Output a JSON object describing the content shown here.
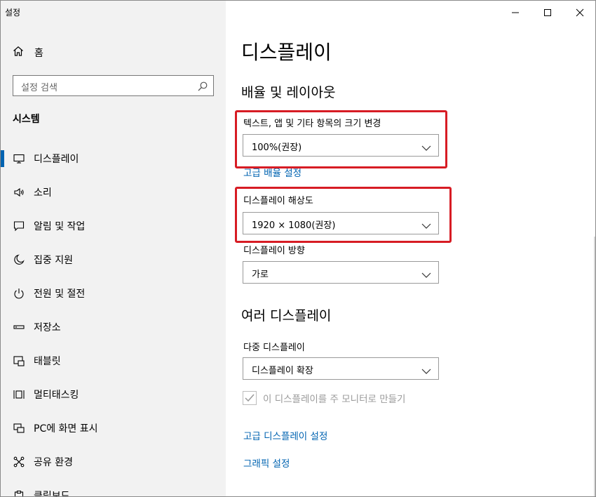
{
  "window": {
    "title": "설정"
  },
  "sidebar": {
    "home_label": "홈",
    "search_placeholder": "설정 검색",
    "section_title": "시스템",
    "items": [
      {
        "label": "디스플레이",
        "icon": "monitor-icon",
        "active": true
      },
      {
        "label": "소리",
        "icon": "speaker-icon"
      },
      {
        "label": "알림 및 작업",
        "icon": "notification-icon"
      },
      {
        "label": "집중 지원",
        "icon": "moon-icon"
      },
      {
        "label": "전원 및 절전",
        "icon": "power-icon"
      },
      {
        "label": "저장소",
        "icon": "storage-icon"
      },
      {
        "label": "태블릿",
        "icon": "tablet-icon"
      },
      {
        "label": "멀티태스킹",
        "icon": "multitasking-icon"
      },
      {
        "label": "PC에 화면 표시",
        "icon": "project-icon"
      },
      {
        "label": "공유 환경",
        "icon": "share-icon"
      },
      {
        "label": "클립보드",
        "icon": "clipboard-icon"
      }
    ]
  },
  "main": {
    "page_title": "디스플레이",
    "scale_section_title": "배율 및 레이아웃",
    "scale_label": "텍스트, 앱 및 기타 항목의 크기 변경",
    "scale_value": "100%(권장)",
    "advanced_scale_link": "고급 배율 설정",
    "resolution_label": "디스플레이 해상도",
    "resolution_value": "1920 × 1080(권장)",
    "orientation_label": "디스플레이 방향",
    "orientation_value": "가로",
    "multi_section_title": "여러 디스플레이",
    "multi_label": "다중 디스플레이",
    "multi_value": "디스플레이 확장",
    "main_display_checkbox": "이 디스플레이를 주 모니터로 만들기",
    "main_display_checked": true,
    "advanced_display_link": "고급 디스플레이 설정",
    "graphics_link": "그래픽 설정"
  },
  "colors": {
    "accent": "#0063b1",
    "highlight_box": "#d71c24",
    "sidebar_bg": "#f2f2f2"
  }
}
